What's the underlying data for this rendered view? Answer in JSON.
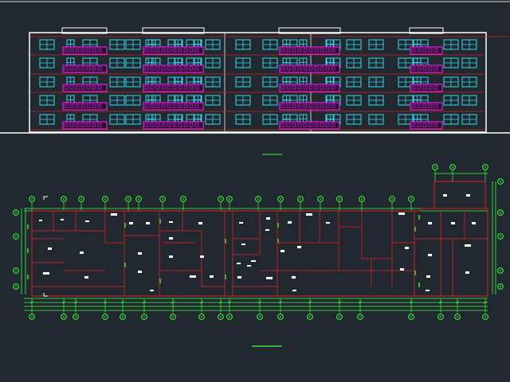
{
  "canvas": {
    "background": "#212830"
  },
  "colors": {
    "outline": "#ffffff",
    "window": "#33ddee",
    "balcony": "#e020e0",
    "floor_line": "#cc2222",
    "dimension": "#39ff39",
    "wall": "#bb2222",
    "label_block": "#ffffff"
  },
  "elevation": {
    "floors": 5,
    "bays": 4
  },
  "floor_plan": {
    "axis_labels_top": [
      "",
      "",
      "",
      "",
      "",
      "",
      "",
      "",
      "",
      "",
      "",
      "",
      "",
      "",
      "",
      "",
      "",
      "",
      "",
      "",
      "",
      "",
      "",
      "",
      "",
      ""
    ],
    "axis_labels_side": [
      "",
      "",
      "",
      "",
      "",
      ""
    ]
  }
}
